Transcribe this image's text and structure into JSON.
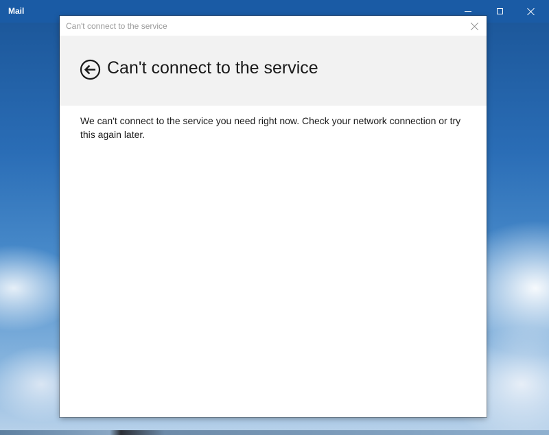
{
  "app": {
    "title": "Mail"
  },
  "window_controls": {
    "minimize_icon": "minimize-icon",
    "maximize_icon": "maximize-icon",
    "close_icon": "close-icon"
  },
  "dialog": {
    "title": "Can't connect to the service",
    "heading": "Can't connect to the service",
    "message": "We can't connect to the service you need right now. Check your network connection or try this again later.",
    "back_icon": "back-arrow-icon",
    "close_icon": "close-icon"
  },
  "colors": {
    "titlebar": "#1a5ba5",
    "header_band": "#f2f2f2",
    "dialog_background": "#ffffff",
    "text": "#1a1a1a",
    "muted_text": "#9a9a9a"
  }
}
